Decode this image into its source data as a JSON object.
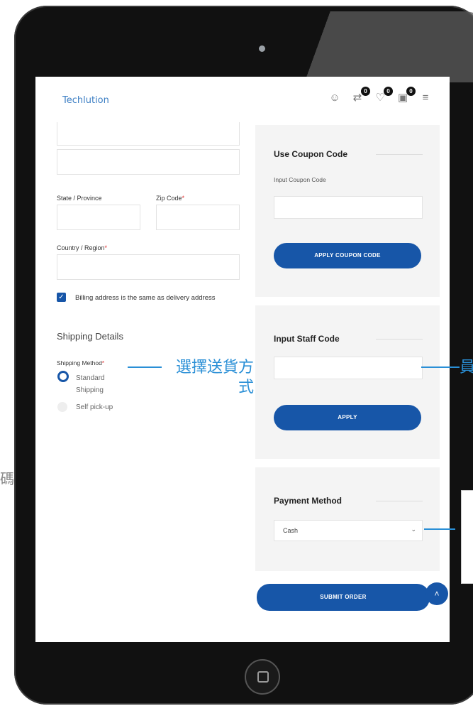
{
  "header": {
    "logo": "Techlution",
    "icons": [
      {
        "name": "support-icon",
        "badge": ""
      },
      {
        "name": "compare-icon",
        "badge": "0"
      },
      {
        "name": "wishlist-icon",
        "badge": "0"
      },
      {
        "name": "cart-icon",
        "badge": "0"
      },
      {
        "name": "menu-icon",
        "badge": ""
      }
    ]
  },
  "form": {
    "state_label": "State / Province",
    "zip_label": "Zip Code",
    "country_label": "Country / Region",
    "required_mark": "*",
    "billing_same": "Billing address is the same as delivery address",
    "shipping_details_title": "Shipping Details",
    "shipping_method_label": "Shipping Method",
    "shipping_options": [
      "Standard Shipping",
      "Self pick-up"
    ]
  },
  "coupon": {
    "title": "Use Coupon Code",
    "input_label": "Input Coupon Code",
    "button": "APPLY COUPON CODE"
  },
  "staff": {
    "title": "Input Staff Code",
    "button": "APPLY"
  },
  "payment": {
    "title": "Payment Method",
    "selected": "Cash"
  },
  "submit": {
    "button": "SUBMIT ORDER",
    "scroll_icon": "chevron-up-icon"
  },
  "annotations": {
    "shipping": "選擇送貨方式",
    "staff_partial": "員",
    "left_partial": "碼"
  },
  "colors": {
    "primary": "#1756a8",
    "annotation": "#2a8fd6",
    "logo": "#3d7fc4"
  }
}
